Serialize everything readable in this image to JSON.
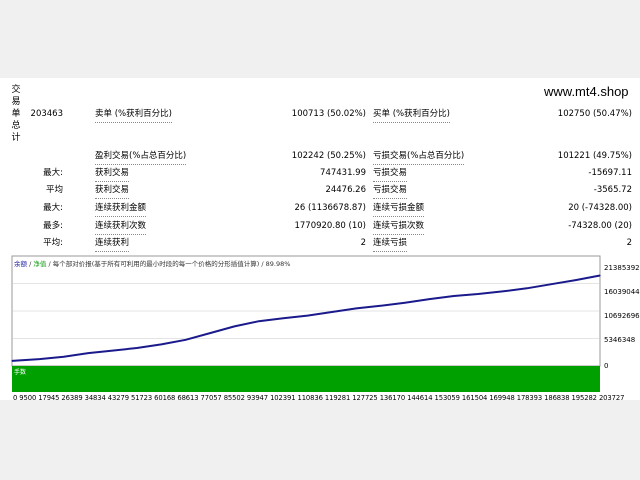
{
  "header": {
    "vertical_label": "交易单总计",
    "site": "www.mt4.shop"
  },
  "stats": {
    "total_trades": "203463",
    "short_label": "卖单 (%获利百分比)",
    "short_value": "100713 (50.02%)",
    "long_label": "买单 (%获利百分比)",
    "long_value": "102750 (50.47%)",
    "profit_trades_label": "盈利交易(%占总百分比)",
    "profit_trades_value": "102242 (50.25%)",
    "loss_trades_label": "亏损交易(%占总百分比)",
    "loss_trades_value": "101221 (49.75%)",
    "max_label": "最大:",
    "max_profit_label": "获利交易",
    "max_profit_value": "747431.99",
    "max_loss_label": "亏损交易",
    "max_loss_value": "-15697.11",
    "avg_label": "平均",
    "avg_profit_label": "获利交易",
    "avg_profit_value": "24476.26",
    "avg_loss_label": "亏损交易",
    "avg_loss_value": "-3565.72",
    "max2_label": "最大:",
    "cons_profit_amount_label": "连续获利金额",
    "cons_profit_amount_value": "26 (1136678.87)",
    "cons_loss_amount_label": "连续亏损金额",
    "cons_loss_amount_value": "20 (-74328.00)",
    "most_label": "最多:",
    "cons_profit_count_label": "连续获利次数",
    "cons_profit_count_value": "1770920.80 (10)",
    "cons_loss_count_label": "连续亏损次数",
    "cons_loss_count_value": "-74328.00 (20)",
    "avg2_label": "平均:",
    "avg_cons_profit_label": "连续获利",
    "avg_cons_profit_value": "2",
    "avg_cons_loss_label": "连续亏损",
    "avg_cons_loss_value": "2"
  },
  "chart": {
    "legend_balance": "余额",
    "legend_sep": "/",
    "legend_equity": "净值",
    "legend_sep2": "/",
    "legend_desc": "每个部对价报(基于所有可利用的最小时段的每一个价格的分形插值计算)",
    "legend_sep3": "/",
    "legend_quality": "89.98%",
    "volume_label": "手数",
    "volume_zero": "0",
    "x_ticks_text": "0 9500 17945 26389 34834 43279 51723 60168 68613 77057 85502 93947 102391 110836 119281 127725 136170 144614 153059 161504 169948 178393 186838 195282 203727"
  },
  "chart_data": {
    "type": "line",
    "title": "",
    "xlabel": "",
    "ylabel": "",
    "x": [
      0,
      9500,
      17945,
      26389,
      34834,
      43279,
      51723,
      60168,
      68613,
      77057,
      85502,
      93947,
      102391,
      110836,
      119281,
      127725,
      136170,
      144614,
      153059,
      161504,
      169948,
      178393,
      186838,
      195282,
      203727
    ],
    "series": [
      {
        "name": "余额",
        "values": [
          1000000,
          1350000,
          1800000,
          2500000,
          3000000,
          3500000,
          4200000,
          5100000,
          6400000,
          7700000,
          8700000,
          9300000,
          9800000,
          10500000,
          11200000,
          11700000,
          12300000,
          13000000,
          13600000,
          14000000,
          14500000,
          15100000,
          15900000,
          16700000,
          17600000
        ]
      }
    ],
    "y_ticks": [
      "21385392",
      "16039044",
      "10692696",
      "5346348",
      "0"
    ],
    "ylim": [
      0,
      21385392
    ],
    "xlim": [
      0,
      203727
    ],
    "colors": {
      "balance": "#1a1a8c",
      "volume": "#00a000",
      "grid": "#c8c8c8"
    },
    "grid": true
  }
}
